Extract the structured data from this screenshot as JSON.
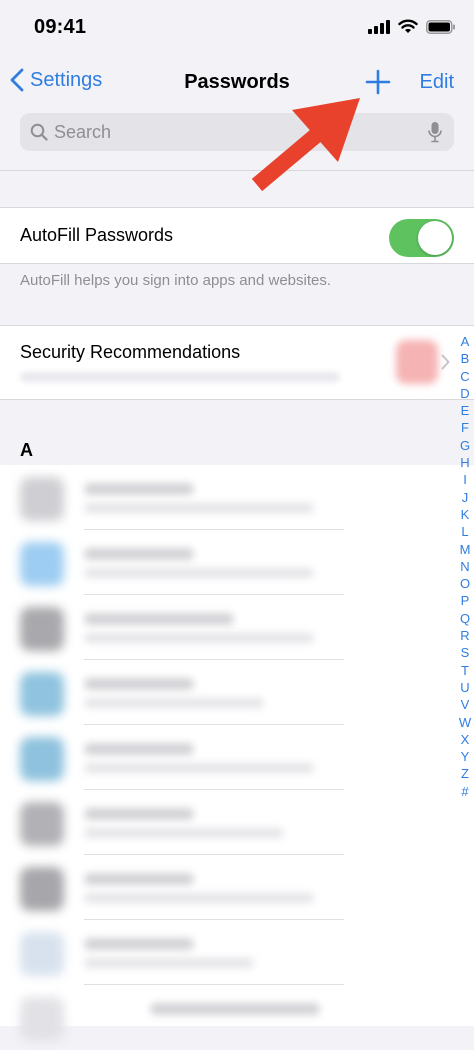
{
  "status_bar": {
    "time": "09:41"
  },
  "nav": {
    "back_label": "Settings",
    "title": "Passwords",
    "edit_label": "Edit"
  },
  "search": {
    "placeholder": "Search"
  },
  "autofill": {
    "label": "AutoFill Passwords",
    "enabled": true,
    "footnote": "AutoFill helps you sign into apps and websites."
  },
  "security": {
    "label": "Security Recommendations"
  },
  "section_header": "A",
  "index": [
    "A",
    "B",
    "C",
    "D",
    "E",
    "F",
    "G",
    "H",
    "I",
    "J",
    "K",
    "L",
    "M",
    "N",
    "O",
    "P",
    "Q",
    "R",
    "S",
    "T",
    "U",
    "V",
    "W",
    "X",
    "Y",
    "Z",
    "#"
  ],
  "colors": {
    "accent": "#2f7de1",
    "toggle_on": "#5ec35f",
    "arrow": "#e8412c"
  },
  "icons": {
    "back": "chevron-left-icon",
    "add": "plus-icon",
    "search": "search-icon",
    "mic": "microphone-icon"
  }
}
